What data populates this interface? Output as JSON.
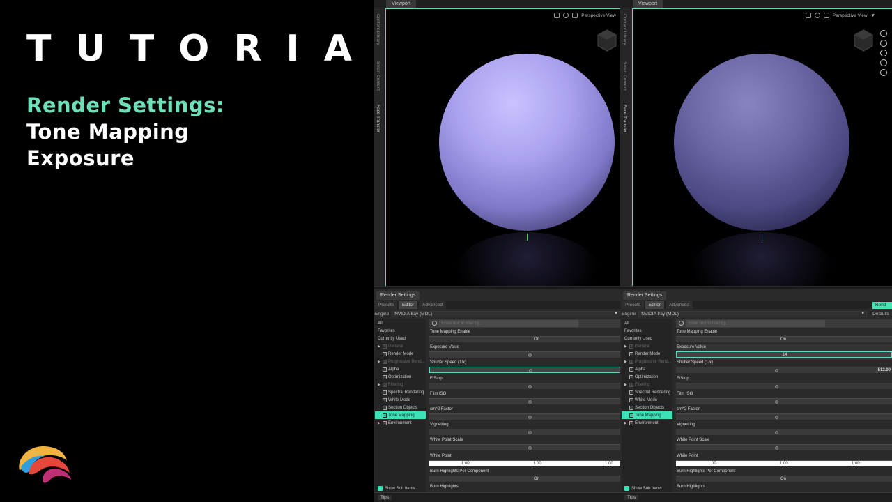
{
  "intro": {
    "headline": "TUTORIAL",
    "topic": "Render Settings:",
    "subtitle_line1": "Tone Mapping",
    "subtitle_line2": "Exposure"
  },
  "colors": {
    "accent": "#6ee0b8",
    "selection": "#3ee0b8",
    "viewport_border": "#5fd6c6"
  },
  "left_app": {
    "viewport_tab": "Viewport",
    "side_tabs": [
      "Content Library",
      "Smart Content",
      "Face Transfer"
    ],
    "camera_view": "Perspective View",
    "render_settings": {
      "title": "Render Settings",
      "tabs": [
        "Presets",
        "Editor",
        "Advanced"
      ],
      "engine_label": "Engine",
      "engine_value": "NVIDIA Iray (MDL)",
      "filter_placeholder": "Enter text to filter by...",
      "tree": [
        "All",
        "Favorites",
        "Currently Used",
        "General",
        "Render Mode",
        "Progressive Rend...",
        "Alpha",
        "Optimization",
        "Filtering",
        "Spectral Rendering",
        "White Mode",
        "Section Objects",
        "Tone Mapping",
        "Environment"
      ],
      "show_sub_items": "Show Sub Items",
      "tips": "Tips",
      "props": {
        "tone_mapping_enable": "Tone Mapping Enable",
        "on": "On",
        "exposure_value": "Exposure Value",
        "shutter_speed": "Shutter Speed (1/x)",
        "fstop": "F/Stop",
        "film_iso": "Film ISO",
        "cm2_factor": "cm^2 Factor",
        "vignetting": "Vignetting",
        "white_point_scale": "White Point Scale",
        "white_point": "White Point",
        "white_point_values": [
          "1.00",
          "1.00",
          "1.00"
        ],
        "burn_highlights_per_component": "Burn Highlights Per Component",
        "burn_highlights": "Burn Highlights"
      }
    }
  },
  "right_app": {
    "viewport_tab": "Viewport",
    "side_tabs": [
      "Content Library",
      "Smart Content",
      "Face Transfer"
    ],
    "camera_view": "Perspective View",
    "render_settings": {
      "title": "Render Settings",
      "tabs": [
        "Presets",
        "Editor",
        "Advanced"
      ],
      "render_button": "Rend",
      "engine_label": "Engine",
      "engine_value": "NVIDIA Iray (MDL)",
      "defaults": "Defaults",
      "filter_placeholder": "Enter text to filter by...",
      "tree": [
        "All",
        "Favorites",
        "Currently Used",
        "General",
        "Render Mode",
        "Progressive Rend...",
        "Alpha",
        "Optimization",
        "Filtering",
        "Spectral Rendering",
        "White Mode",
        "Section Objects",
        "Tone Mapping",
        "Environment"
      ],
      "show_sub_items": "Show Sub Items",
      "tips": "Tips",
      "props": {
        "tone_mapping_enable": "Tone Mapping Enable",
        "on": "On",
        "exposure_value": "Exposure Value",
        "exposure_input": "14",
        "shutter_speed": "Shutter Speed (1/x)",
        "shutter_value": "512.00",
        "fstop": "F/Stop",
        "film_iso": "Film ISO",
        "cm2_factor": "cm^2 Factor",
        "vignetting": "Vignetting",
        "white_point_scale": "White Point Scale",
        "white_point": "White Point",
        "white_point_values": [
          "1.00",
          "1.00",
          "1.00"
        ],
        "burn_highlights_per_component": "Burn Highlights Per Component",
        "burn_highlights": "Burn Highlights"
      }
    }
  }
}
